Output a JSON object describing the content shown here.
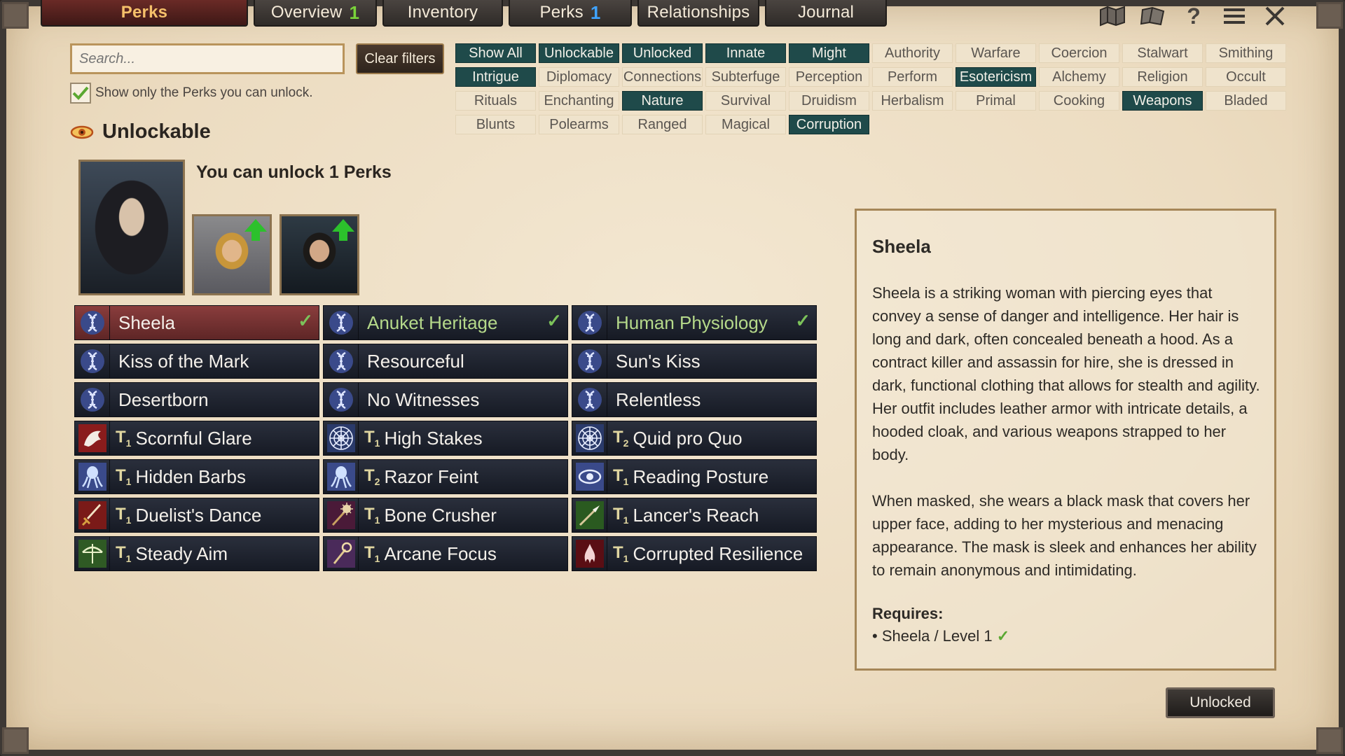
{
  "tabs": [
    {
      "label": "Perks",
      "badge": ""
    },
    {
      "label": "Overview",
      "badge": "1"
    },
    {
      "label": "Inventory",
      "badge": ""
    },
    {
      "label": "Perks",
      "badge": "1"
    },
    {
      "label": "Relationships",
      "badge": ""
    },
    {
      "label": "Journal",
      "badge": ""
    }
  ],
  "top_icons": [
    "map-icon",
    "book-icon",
    "help-icon",
    "menu-icon",
    "close-icon"
  ],
  "search": {
    "placeholder": "Search...",
    "value": ""
  },
  "clear_filters": "Clear filters",
  "only_unlockable": {
    "label": "Show only the Perks you can unlock.",
    "checked": true
  },
  "filters": [
    {
      "label": "Show All",
      "on": true
    },
    {
      "label": "Unlockable",
      "on": true
    },
    {
      "label": "Unlocked",
      "on": true
    },
    {
      "label": "Innate",
      "on": true
    },
    {
      "label": "Might",
      "on": true
    },
    {
      "label": "Authority",
      "on": false
    },
    {
      "label": "Warfare",
      "on": false
    },
    {
      "label": "Coercion",
      "on": false
    },
    {
      "label": "Stalwart",
      "on": false
    },
    {
      "label": "Smithing",
      "on": false
    },
    {
      "label": "Intrigue",
      "on": true
    },
    {
      "label": "Diplomacy",
      "on": false
    },
    {
      "label": "Connections",
      "on": false
    },
    {
      "label": "Subterfuge",
      "on": false
    },
    {
      "label": "Perception",
      "on": false
    },
    {
      "label": "Perform",
      "on": false
    },
    {
      "label": "Esotericism",
      "on": true
    },
    {
      "label": "Alchemy",
      "on": false
    },
    {
      "label": "Religion",
      "on": false
    },
    {
      "label": "Occult",
      "on": false
    },
    {
      "label": "Rituals",
      "on": false
    },
    {
      "label": "Enchanting",
      "on": false
    },
    {
      "label": "Nature",
      "on": true
    },
    {
      "label": "Survival",
      "on": false
    },
    {
      "label": "Druidism",
      "on": false
    },
    {
      "label": "Herbalism",
      "on": false
    },
    {
      "label": "Primal",
      "on": false
    },
    {
      "label": "Cooking",
      "on": false
    },
    {
      "label": "Weapons",
      "on": true
    },
    {
      "label": "Bladed",
      "on": false
    },
    {
      "label": "Blunts",
      "on": false
    },
    {
      "label": "Polearms",
      "on": false
    },
    {
      "label": "Ranged",
      "on": false
    },
    {
      "label": "Magical",
      "on": false
    },
    {
      "label": "Corruption",
      "on": true
    }
  ],
  "section_title": "Unlockable",
  "can_unlock_text": "You can unlock 1 Perks",
  "portraits": [
    "main-character-portrait",
    "companion-portrait-blond",
    "companion-portrait-dark"
  ],
  "perks": [
    {
      "name": "Sheela",
      "tier": "",
      "icon": "dna-icon",
      "selected": true,
      "checked": true,
      "green": false
    },
    {
      "name": "Anuket Heritage",
      "tier": "",
      "icon": "dna-icon",
      "selected": false,
      "checked": true,
      "green": true
    },
    {
      "name": "Human Physiology",
      "tier": "",
      "icon": "dna-icon",
      "selected": false,
      "checked": true,
      "green": true
    },
    {
      "name": "Kiss of the Mark",
      "tier": "",
      "icon": "dna-icon",
      "selected": false,
      "checked": false,
      "green": false
    },
    {
      "name": "Resourceful",
      "tier": "",
      "icon": "dna-icon",
      "selected": false,
      "checked": false,
      "green": false
    },
    {
      "name": "Sun's Kiss",
      "tier": "",
      "icon": "dna-icon",
      "selected": false,
      "checked": false,
      "green": false
    },
    {
      "name": "Desertborn",
      "tier": "",
      "icon": "dna-icon",
      "selected": false,
      "checked": false,
      "green": false
    },
    {
      "name": "No Witnesses",
      "tier": "",
      "icon": "dna-icon",
      "selected": false,
      "checked": false,
      "green": false
    },
    {
      "name": "Relentless",
      "tier": "",
      "icon": "dna-icon",
      "selected": false,
      "checked": false,
      "green": false
    },
    {
      "name": "Scornful Glare",
      "tier": "1",
      "icon": "dragon-icon",
      "selected": false,
      "checked": false,
      "green": false
    },
    {
      "name": "High Stakes",
      "tier": "1",
      "icon": "web-icon",
      "selected": false,
      "checked": false,
      "green": false
    },
    {
      "name": "Quid pro Quo",
      "tier": "2",
      "icon": "web-icon",
      "selected": false,
      "checked": false,
      "green": false
    },
    {
      "name": "Hidden Barbs",
      "tier": "1",
      "icon": "squid-icon",
      "selected": false,
      "checked": false,
      "green": false
    },
    {
      "name": "Razor Feint",
      "tier": "2",
      "icon": "squid-icon",
      "selected": false,
      "checked": false,
      "green": false
    },
    {
      "name": "Reading Posture",
      "tier": "1",
      "icon": "eye-icon",
      "selected": false,
      "checked": false,
      "green": false
    },
    {
      "name": "Duelist's Dance",
      "tier": "1",
      "icon": "sword-icon",
      "selected": false,
      "checked": false,
      "green": false
    },
    {
      "name": "Bone Crusher",
      "tier": "1",
      "icon": "mace-icon",
      "selected": false,
      "checked": false,
      "green": false
    },
    {
      "name": "Lancer's Reach",
      "tier": "1",
      "icon": "spear-icon",
      "selected": false,
      "checked": false,
      "green": false
    },
    {
      "name": "Steady Aim",
      "tier": "1",
      "icon": "bow-icon",
      "selected": false,
      "checked": false,
      "green": false
    },
    {
      "name": "Arcane Focus",
      "tier": "1",
      "icon": "staff-icon",
      "selected": false,
      "checked": false,
      "green": false
    },
    {
      "name": "Corrupted Resilience",
      "tier": "1",
      "icon": "corruption-icon",
      "selected": false,
      "checked": false,
      "green": false
    }
  ],
  "detail": {
    "title": "Sheela",
    "para1": "Sheela is a striking woman with piercing eyes that convey a sense of danger and intelligence. Her hair is long and dark, often concealed beneath a hood. As a contract killer and assassin for hire, she is dressed in dark, functional clothing that allows for stealth and agility. Her outfit includes leather armor with intricate details, a hooded cloak, and various weapons strapped to her body.",
    "para2": "When masked, she wears a black mask that covers her upper face, adding to her mysterious and menacing appearance. The mask is sleek and enhances her ability to remain anonymous and intimidating.",
    "requires_label": "Requires:",
    "requirement": "Sheela / Level 1"
  },
  "status_button": "Unlocked",
  "colors": {
    "accent": "#1f4a4a",
    "tab_active": "#6a2a26",
    "perk_bg": "#1e2330",
    "selected_perk": "#8a3d3d",
    "check": "#7cc25a"
  }
}
